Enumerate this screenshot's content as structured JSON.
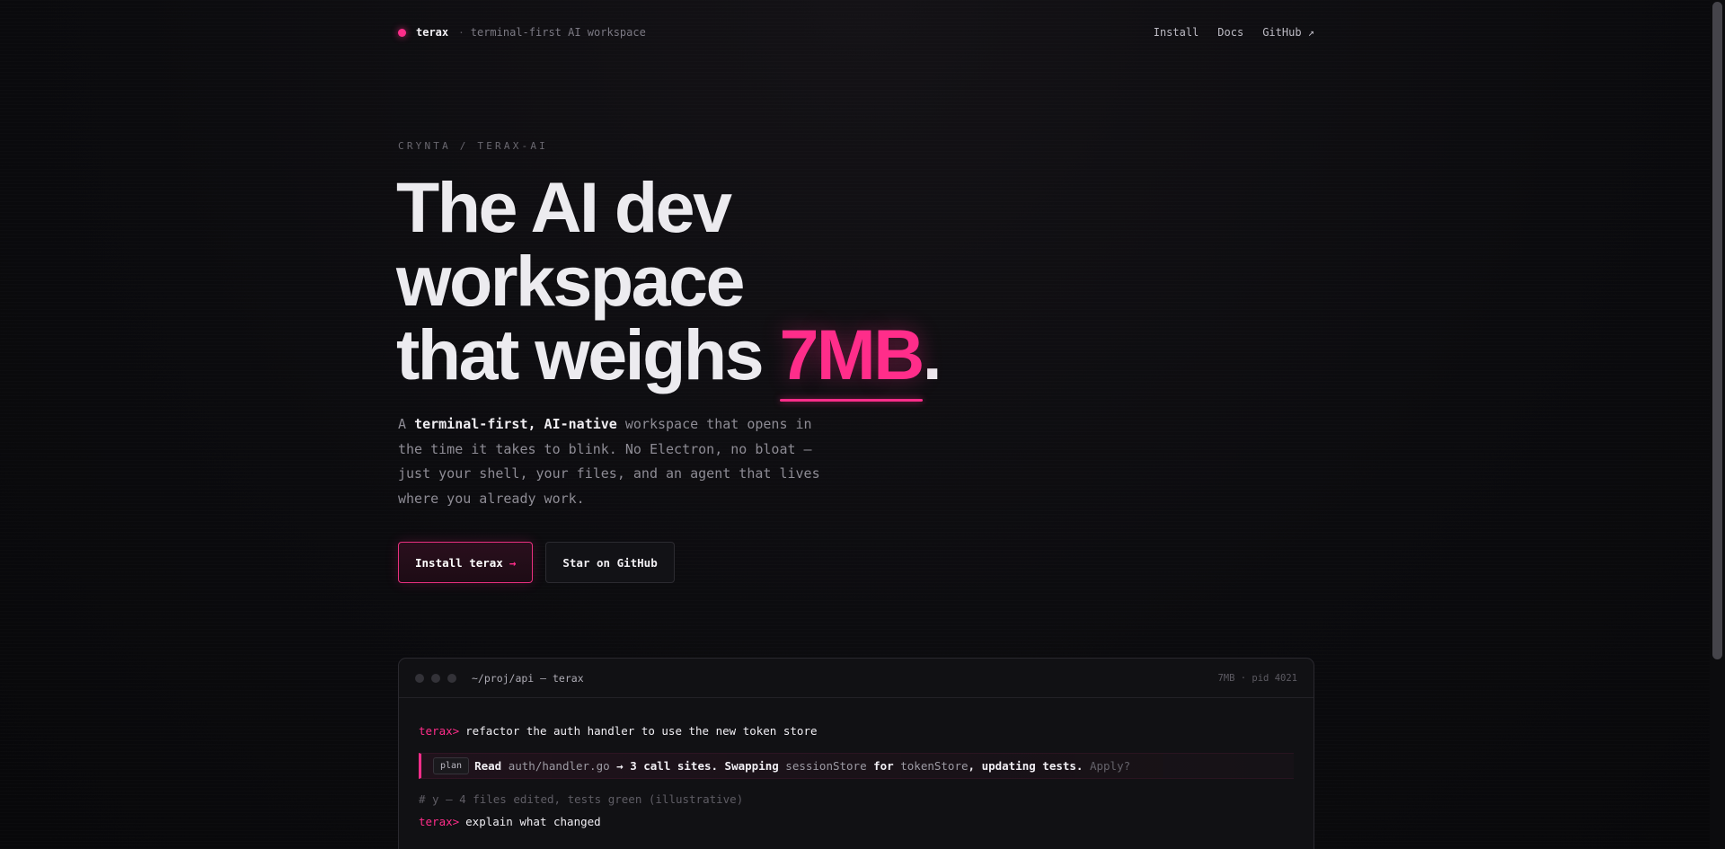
{
  "brand": {
    "name": "terax",
    "separator": "·",
    "tagline": "terminal-first AI workspace"
  },
  "nav": {
    "links": [
      "Install",
      "Docs",
      "GitHub ↗"
    ]
  },
  "eyebrow": "CRYNTA / TERAX-AI",
  "hero": {
    "line1": "The AI dev",
    "line2": "workspace",
    "line3_prefix": "that weighs ",
    "line3_accent": "7MB",
    "line3_suffix": "."
  },
  "description": {
    "prefix": "A ",
    "bold": "terminal-first, AI-native",
    "rest": " workspace that opens in the time it takes to blink. No Electron, no bloat — just your shell, your files, and an agent that lives where you already work."
  },
  "buttons": {
    "primary_label": "Install terax",
    "primary_arrow": "→",
    "secondary_label": "Star on GitHub"
  },
  "terminal": {
    "title": "~/proj/api — terax",
    "meta": "7MB · pid 4021",
    "prompt": "terax>",
    "command1": "refactor the auth handler to use the new token store",
    "plan": {
      "tag": "plan",
      "read": "Read ",
      "file": "auth/handler.go",
      "middle": " → 3 call sites. Swapping ",
      "old": "sessionStore",
      "for": " for ",
      "new": "tokenStore",
      "end": ", updating tests. ",
      "question": "Apply?"
    },
    "comment": "# y — 4 files edited, tests green (illustrative)",
    "command2": "explain what changed"
  },
  "colors": {
    "accent": "#ff2d8a",
    "background": "#0b0b0e"
  }
}
